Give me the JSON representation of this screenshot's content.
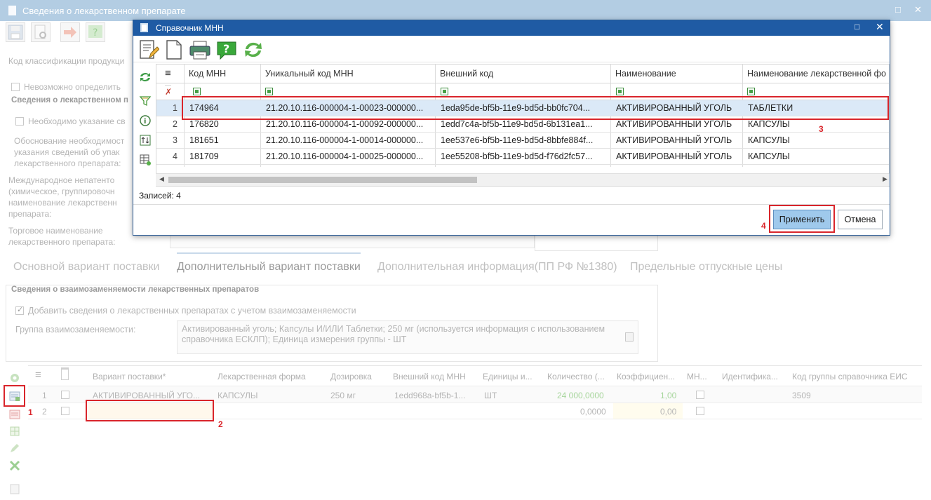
{
  "bg_window": {
    "title": "Сведения о лекарственном препарате",
    "max_glyph": "□",
    "close_glyph": "✕",
    "labels": {
      "code_class": "Код классификации продукци",
      "cannot_determine": "Невозможно определить",
      "section_lek": "Сведения о лекарственном п",
      "need_indicate": "Необходимо указание св",
      "justification_1": "Обоснование необходимост",
      "justification_2": "указания сведений об упак",
      "justification_3": "лекарственного препарата:",
      "inn_1": "Международное непатенто",
      "inn_2": "(химическое, группировочн",
      "inn_3": "наименование лекарственн",
      "inn_4": "препарата:",
      "trade_1": "Торговое наименование",
      "trade_2": "лекарственного препарата:"
    },
    "tabs": [
      "Основной вариант поставки",
      "Дополнительный вариант поставки",
      "Дополнительная информация(ПП РФ №1380)",
      "Предельные отпускные цены"
    ],
    "interchange": {
      "section_title": "Сведения о взаимозаменяемости лекарственных препаратов",
      "add_checkbox_label": "Добавить сведения о лекарственных препаратах с учетом взаимозаменяемости",
      "group_label": "Группа взаимозаменяемости:",
      "group_value_1": "Активированный уголь; Капсулы И/ИЛИ Таблетки; 250 мг (используется информация с использованием",
      "group_value_2": "справочника ЕСКЛП); Единица измерения группы - ШТ"
    },
    "grid": {
      "menu_glyph": "≡",
      "headers": [
        "Вариант поставки*",
        "Лекарственная форма",
        "Дозировка",
        "Внешний код МНН",
        "Единицы и...",
        "Количество (...",
        "Коэффициен...",
        "МН...",
        "Идентифика...",
        "Код группы справочника ЕИС"
      ],
      "rows": [
        {
          "num": "1",
          "variant": "АКТИВИРОВАННЫЙ УГО...",
          "form": "КАПСУЛЫ",
          "dose": "250 мг",
          "ext_code": "1edd968a-bf5b-1...",
          "unit": "ШТ",
          "qty": "24 000,0000",
          "coef": "1,00",
          "ident": "",
          "group_code": "3509"
        },
        {
          "num": "2",
          "variant": "",
          "form": "",
          "dose": "",
          "ext_code": "",
          "unit": "",
          "qty": "0,0000",
          "coef": "0,00",
          "ident": "",
          "group_code": ""
        }
      ]
    }
  },
  "annotations": {
    "n1": "1",
    "n2": "2",
    "n3": "3",
    "n4": "4"
  },
  "modal": {
    "title": "Справочник МНН",
    "max_glyph": "□",
    "close_glyph": "✕",
    "menu_glyph": "≡",
    "columns": [
      "Код МНН",
      "Уникальный код МНН",
      "Внешний код",
      "Наименование",
      "Наименование лекарственной фо"
    ],
    "rows": [
      {
        "num": "1",
        "code": "174964",
        "unique": "21.20.10.116-000004-1-00023-000000...",
        "ext": "1eda95de-bf5b-11e9-bd5d-bb0fc704...",
        "name": "АКТИВИРОВАННЫЙ УГОЛЬ",
        "form": "ТАБЛЕТКИ"
      },
      {
        "num": "2",
        "code": "176820",
        "unique": "21.20.10.116-000004-1-00092-000000...",
        "ext": "1edd7c4a-bf5b-11e9-bd5d-6b131ea1...",
        "name": "АКТИВИРОВАННЫЙ УГОЛЬ",
        "form": "КАПСУЛЫ"
      },
      {
        "num": "3",
        "code": "181651",
        "unique": "21.20.10.116-000004-1-00014-000000...",
        "ext": "1ee537e6-bf5b-11e9-bd5d-8bbfe884f...",
        "name": "АКТИВИРОВАННЫЙ УГОЛЬ",
        "form": "КАПСУЛЫ"
      },
      {
        "num": "4",
        "code": "181709",
        "unique": "21.20.10.116-000004-1-00025-000000...",
        "ext": "1ee55208-bf5b-11e9-bd5d-f76d2fc57...",
        "name": "АКТИВИРОВАННЫЙ УГОЛЬ",
        "form": "КАПСУЛЫ"
      }
    ],
    "records_label": "Записей: 4",
    "apply_label": "Применить",
    "cancel_label": "Отмена",
    "colors": {
      "title_bg": "#1f5ba4",
      "selected_row": "#dbe9f7",
      "apply_bg": "#9fc9ec"
    }
  }
}
